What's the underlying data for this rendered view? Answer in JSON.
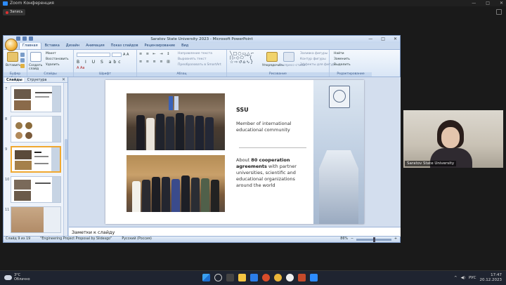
{
  "zoom": {
    "title": "Zoom Конференция",
    "recording_label": "Запись"
  },
  "ppt": {
    "window_title": "Saratov State University 2023 - Microsoft PowerPoint",
    "tabs": [
      {
        "label": "Главная"
      },
      {
        "label": "Вставка"
      },
      {
        "label": "Дизайн"
      },
      {
        "label": "Анимация"
      },
      {
        "label": "Показ слайдов"
      },
      {
        "label": "Рецензирование"
      },
      {
        "label": "Вид"
      }
    ],
    "ribbon": {
      "groups": [
        {
          "label": "Буфер обмена"
        },
        {
          "label": "Слайды"
        },
        {
          "label": "Шрифт"
        },
        {
          "label": "Абзац"
        },
        {
          "label": "Рисование"
        },
        {
          "label": "Редактирование"
        }
      ],
      "paste_label": "Вставить",
      "create_slide_label": "Создать слайд",
      "layout_label": "Макет",
      "restore_label": "Восстановить",
      "delete_label": "Удалить",
      "text_direction_label": "Направление текста",
      "align_text_label": "Выровнять текст",
      "smartart_label": "Преобразовать в SmartArt",
      "arrange_label": "Упорядочить",
      "quick_styles_label": "Экспресс-стили",
      "shape_fill_label": "Заливка фигуры",
      "shape_outline_label": "Контур фигуры",
      "shape_effects_label": "Эффекты для фигур",
      "find_label": "Найти",
      "replace_label": "Заменить",
      "select_label": "Выделить"
    },
    "left_pane": {
      "tab_slides": "Слайды",
      "tab_outline": "Структура",
      "thumb_numbers": [
        "7",
        "8",
        "9",
        "10",
        "11"
      ]
    },
    "slide": {
      "heading": "SSU",
      "subtitle": "Member of international educational community",
      "coop_prefix": "About ",
      "coop_bold": "80 cooperation agreements",
      "coop_rest": " with partner universities, scientific and educational organizations around the world"
    },
    "notes_placeholder": "Заметки к слайду",
    "status": {
      "slide_counter": "Слайд 9 из 19",
      "theme": "\"Engineering Project Proposal by Slidesgo\"",
      "language": "Русский (Россия)",
      "zoom": "86%"
    }
  },
  "video": {
    "participant_name": "Saratov State University"
  },
  "taskbar": {
    "weather_temp": "3°C",
    "weather_desc": "Облачно",
    "lang": "РУС",
    "time": "17:47",
    "date": "20.12.2023"
  },
  "colors": {
    "ppt_ribbon": "#d9e6f6",
    "selected_thumb_border": "#f0a830",
    "taskbar": "#1f2430"
  }
}
